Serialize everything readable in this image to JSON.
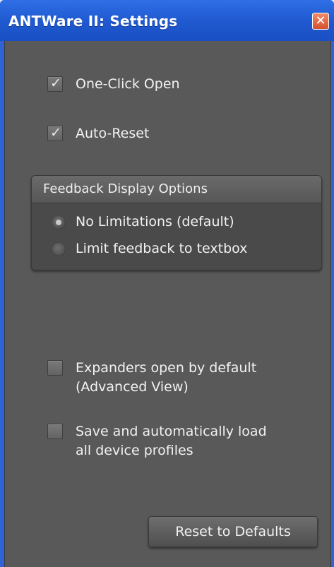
{
  "window": {
    "title": "ANTWare II: Settings",
    "close_glyph": "✕",
    "colors": {
      "titlebar": "#1f58cf",
      "client_bg": "#595959",
      "text": "#f2f2f2"
    }
  },
  "options": {
    "one_click_open": {
      "label": "One-Click Open",
      "checked": true
    },
    "auto_reset": {
      "label": "Auto-Reset",
      "checked": true
    },
    "expanders_open": {
      "label_line1": "Expanders open by default",
      "label_line2": "(Advanced View)",
      "checked": false
    },
    "save_profiles": {
      "label_line1": "Save and automatically load",
      "label_line2": "all device profiles",
      "checked": false
    }
  },
  "check_glyph": "✓",
  "feedback_group": {
    "title": "Feedback Display Options",
    "options": [
      {
        "label": "No Limitations (default)",
        "selected": true
      },
      {
        "label": "Limit feedback to textbox",
        "selected": false
      }
    ]
  },
  "reset_button": {
    "label": "Reset to Defaults"
  }
}
